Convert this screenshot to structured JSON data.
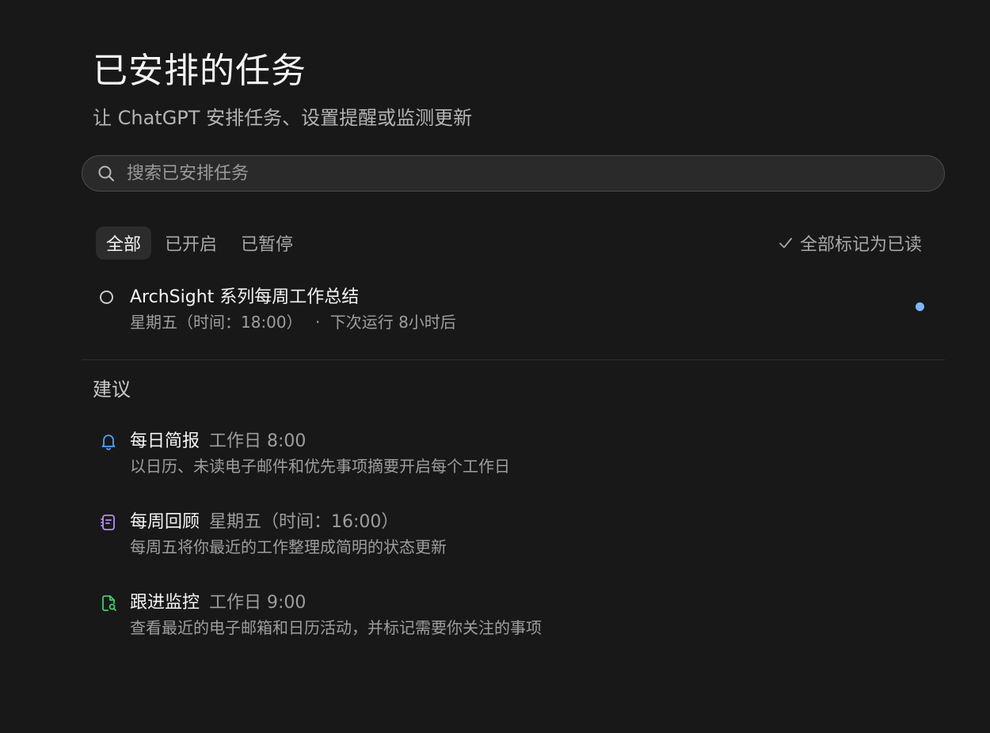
{
  "header": {
    "title": "已安排的任务",
    "subtitle": "让 ChatGPT 安排任务、设置提醒或监测更新"
  },
  "search": {
    "placeholder": "搜索已安排任务",
    "value": ""
  },
  "tabs": [
    {
      "label": "全部",
      "active": true
    },
    {
      "label": "已开启",
      "active": false
    },
    {
      "label": "已暂停",
      "active": false
    }
  ],
  "mark_all_read": {
    "label": "全部标记为已读"
  },
  "tasks": [
    {
      "title": "ArchSight 系列每周工作总结",
      "schedule": "星期五（时间：18:00）",
      "separator": "·",
      "next_run": "下次运行 8小时后",
      "unread": true
    }
  ],
  "suggestions": {
    "title": "建议",
    "items": [
      {
        "icon": "bell-icon",
        "icon_color": "#4aa3ff",
        "name": "每日简报",
        "schedule": "工作日 8:00",
        "description": "以日历、未读电子邮件和优先事项摘要开启每个工作日"
      },
      {
        "icon": "notes-icon",
        "icon_color": "#b68cff",
        "name": "每周回顾",
        "schedule": "星期五（时间：16:00）",
        "description": "每周五将你最近的工作整理成简明的状态更新"
      },
      {
        "icon": "document-search-icon",
        "icon_color": "#3ecf6e",
        "name": "跟进监控",
        "schedule": "工作日 9:00",
        "description": "查看最近的电子邮箱和日历活动，并标记需要你关注的事项"
      }
    ]
  },
  "colors": {
    "background": "#181818",
    "unread_dot": "#7ab7ff"
  }
}
